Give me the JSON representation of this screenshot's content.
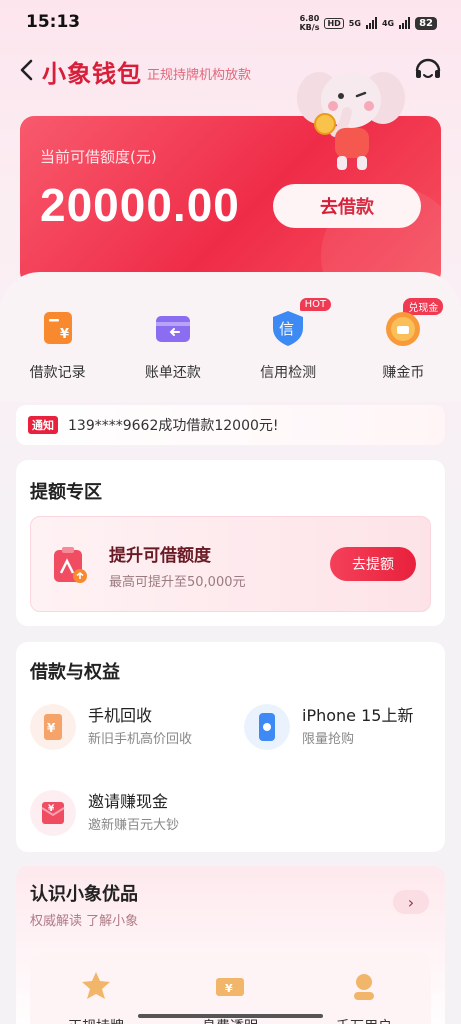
{
  "status_bar": {
    "time": "15:13",
    "net_speed_value": "6.80",
    "net_speed_unit": "KB/s",
    "hd": "HD",
    "net1": "5G",
    "net2": "4G",
    "battery": "82"
  },
  "header": {
    "title": "小象钱包",
    "subtitle": "正规持牌机构放款"
  },
  "credit": {
    "label": "当前可借额度(元)",
    "amount": "20000.00",
    "button": "去借款"
  },
  "quick_actions": [
    {
      "label": "借款记录",
      "icon": "loan-record-icon"
    },
    {
      "label": "账单还款",
      "icon": "bill-repay-icon"
    },
    {
      "label": "信用检测",
      "icon": "credit-check-icon",
      "badge": "HOT",
      "icon_text": "信"
    },
    {
      "label": "赚金币",
      "icon": "coin-icon",
      "badge": "兑现金"
    }
  ],
  "notice": {
    "tag": "通知",
    "text": "139****9662成功借款12000元!"
  },
  "boost": {
    "section_title": "提额专区",
    "title": "提升可借额度",
    "desc": "最高可提升至50,000元",
    "button": "去提额"
  },
  "benefits": {
    "section_title": "借款与权益",
    "items": [
      {
        "title": "手机回收",
        "desc": "新旧手机高价回收",
        "icon": "phone-recycle-icon"
      },
      {
        "title": "iPhone 15上新",
        "desc": "限量抢购",
        "icon": "iphone-icon"
      },
      {
        "title": "邀请赚现金",
        "desc": "邀新赚百元大钞",
        "icon": "red-envelope-icon"
      }
    ]
  },
  "know": {
    "section_title": "认识小象优品",
    "subtitle": "权威解读 了解小象",
    "features": [
      {
        "label": "正规持牌",
        "icon": "star-badge-icon"
      },
      {
        "label": "息费透明",
        "icon": "ticket-icon"
      },
      {
        "label": "千万用户",
        "icon": "user-icon"
      }
    ]
  },
  "colors": {
    "brand": "#e8213c",
    "title": "#d81f3a"
  }
}
